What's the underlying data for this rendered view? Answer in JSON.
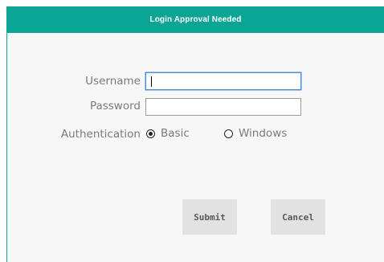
{
  "dialog": {
    "title": "Login Approval Needed"
  },
  "form": {
    "username_label": "Username",
    "username_value": "",
    "password_label": "Password",
    "password_value": "",
    "authentication_label": "Authentication",
    "auth_options": [
      {
        "label": "Basic",
        "selected": true
      },
      {
        "label": "Windows",
        "selected": false
      }
    ]
  },
  "actions": {
    "submit_label": "Submit",
    "cancel_label": "Cancel"
  },
  "colors": {
    "accent": "#0aa594",
    "dialog_bg": "#f7f7f7",
    "label_text": "#7a7a7a",
    "button_bg": "#e2e2e2",
    "focus_border": "#4a90d9"
  }
}
